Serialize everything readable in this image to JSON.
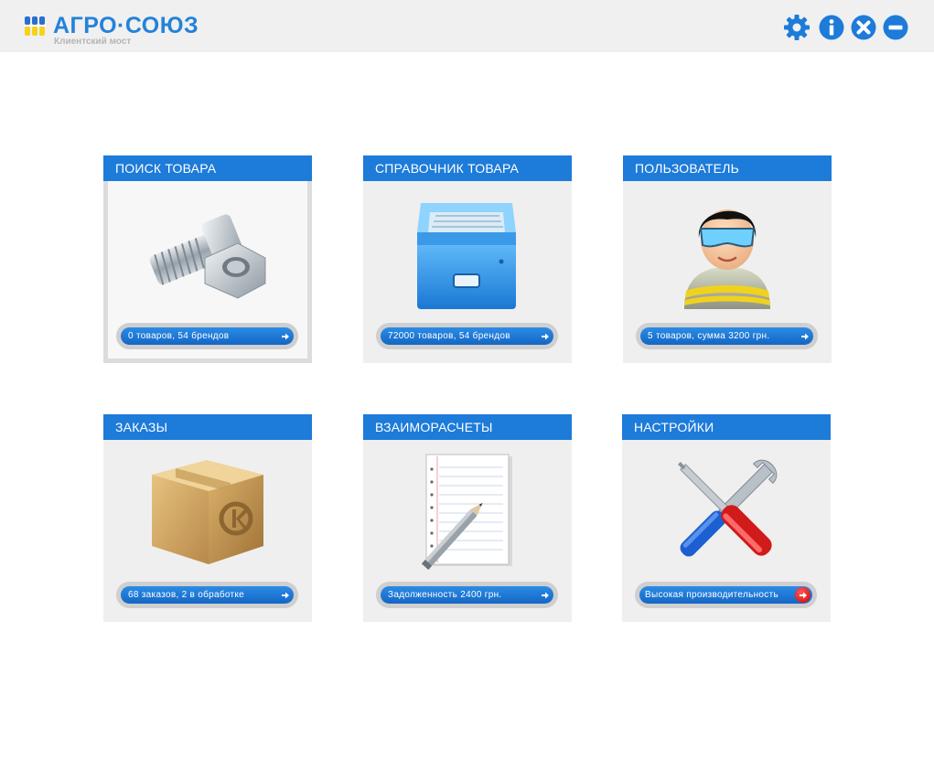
{
  "app": {
    "logo_text": "АГРО·СОЮЗ",
    "logo_subtitle": "Клиентский мост"
  },
  "toolbar": {
    "icons": [
      "gear-icon",
      "info-icon",
      "close-icon",
      "minimize-icon"
    ],
    "accent_color": "#1d7bd9"
  },
  "tiles": [
    {
      "title": "ПОИСК ТОВАРА",
      "status": "0 товаров, 54 брендов",
      "icon": "bolt-nut-icon",
      "arrow": "blue"
    },
    {
      "title": "СПРАВОЧНИК ТОВАРА",
      "status": "72000 товаров, 54 брендов",
      "icon": "file-cabinet-icon",
      "arrow": "blue"
    },
    {
      "title": "ПОЛЬЗОВАТЕЛЬ",
      "status": "5 товаров, сумма 3200 грн.",
      "icon": "user-avatar-icon",
      "arrow": "blue"
    },
    {
      "title": "ЗАКАЗЫ",
      "status": "68 заказов, 2 в обработке",
      "icon": "package-box-icon",
      "arrow": "blue"
    },
    {
      "title": "ВЗАИМОРАСЧЕТЫ",
      "status": "Задолженность 2400 грн.",
      "icon": "notepad-pencil-icon",
      "arrow": "blue"
    },
    {
      "title": "НАСТРОЙКИ",
      "status": "Высокая производительность",
      "icon": "tools-icon",
      "arrow": "red"
    }
  ],
  "colors": {
    "header_blue": "#1d7bd9",
    "tile_background": "#efefef",
    "status_arrow_alert": "#e00000"
  }
}
